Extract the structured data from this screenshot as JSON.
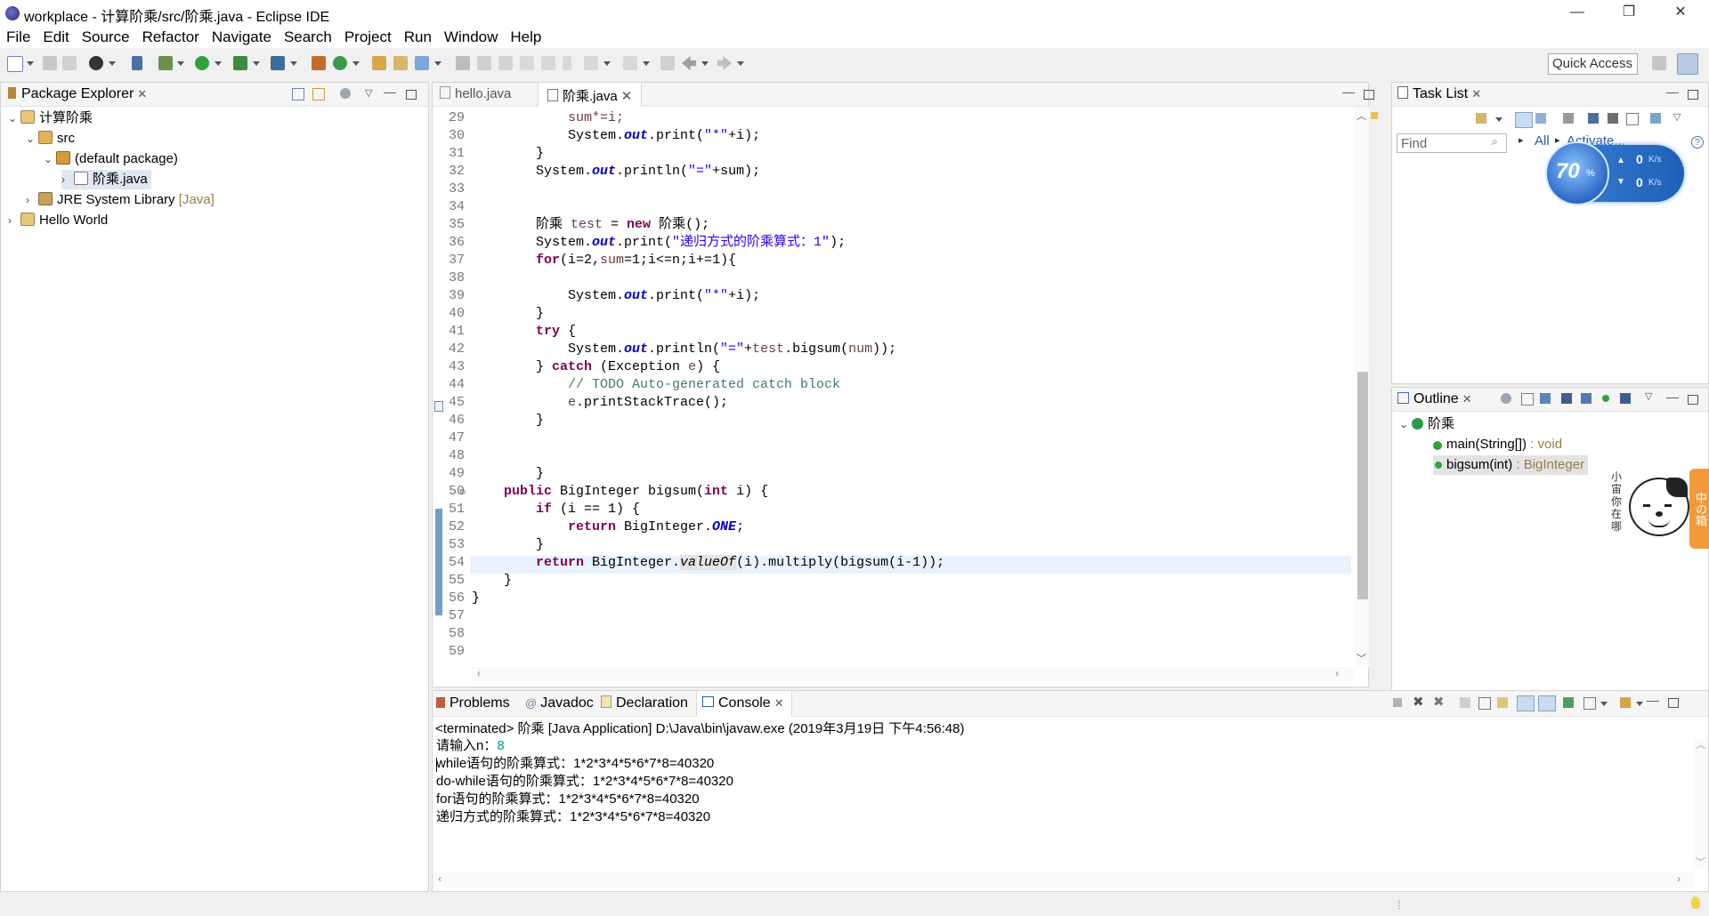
{
  "window": {
    "title": "workplace - 计算阶乘/src/阶乘.java - Eclipse IDE",
    "minimize": "—",
    "maximize": "❐",
    "close": "✕"
  },
  "menu": [
    "File",
    "Edit",
    "Source",
    "Refactor",
    "Navigate",
    "Search",
    "Project",
    "Run",
    "Window",
    "Help"
  ],
  "toolbar": {
    "quick_access": "Quick Access"
  },
  "package_explorer": {
    "title": "Package Explorer",
    "tree": [
      {
        "label": "计算阶乘",
        "chev": "⌄",
        "icon": "project-icon"
      },
      {
        "label": "src",
        "chev": "⌄",
        "icon": "source-folder-icon"
      },
      {
        "label": "(default package)",
        "chev": "⌄",
        "icon": "package-icon"
      },
      {
        "label": "阶乘.java",
        "chev": "›",
        "icon": "java-file-icon"
      },
      {
        "label": "JRE System Library",
        "suffix": "[Java]",
        "chev": "›",
        "icon": "library-icon"
      },
      {
        "label": "Hello World",
        "chev": "›",
        "icon": "project-icon"
      }
    ]
  },
  "editor": {
    "tabs": [
      {
        "label": "hello.java",
        "active": false
      },
      {
        "label": "阶乘.java",
        "active": true
      }
    ],
    "line_numbers": [
      "29",
      "30",
      "31",
      "32",
      "33",
      "34",
      "35",
      "36",
      "37",
      "38",
      "39",
      "40",
      "41",
      "42",
      "43",
      "44",
      "45",
      "46",
      "47",
      "48",
      "49",
      "50",
      "51",
      "52",
      "53",
      "54",
      "55",
      "56",
      "57",
      "58",
      "59"
    ],
    "code": {
      "l29": "sum*=i;",
      "l30a": "System.",
      "l30b": "out",
      "l30c": ".print(",
      "l30d": "\"*\"",
      "l30e": "+i);",
      "l31": "}",
      "l32a": "System.",
      "l32b": "out",
      "l32c": ".println(",
      "l32d": "\"=\"",
      "l32e": "+sum);",
      "l35a": "阶乘 ",
      "l35b": "test",
      "l35c": " = ",
      "l35d": "new",
      "l35e": " 阶乘();",
      "l36a": "System.",
      "l36b": "out",
      "l36c": ".print(",
      "l36d": "\"递归方式的阶乘算式：1\"",
      "l36e": ");",
      "l37a": "for",
      "l37b": "(i=2,",
      "l37c": "sum",
      "l37d": "=1;i<=n;i+=1){",
      "l39a": "System.",
      "l39b": "out",
      "l39c": ".print(",
      "l39d": "\"*\"",
      "l39e": "+i);",
      "l40": "}",
      "l41a": "try",
      "l41b": " {",
      "l42a": "System.",
      "l42b": "out",
      "l42c": ".println(",
      "l42d": "\"=\"",
      "l42e": "+",
      "l42f": "test",
      "l42g": ".bigsum(",
      "l42h": "num",
      "l42i": "));",
      "l43a": "} ",
      "l43b": "catch",
      "l43c": " (Exception ",
      "l43d": "e",
      "l43e": ") {",
      "l44": "// TODO Auto-generated catch block",
      "l45a": "e",
      "l45b": ".printStackTrace();",
      "l46": "}",
      "l49": "}",
      "l50a": "public",
      "l50b": " BigInteger bigsum(",
      "l50c": "int",
      "l50d": " i) {",
      "l51a": "if",
      "l51b": " (i == 1) {",
      "l52a": "return",
      "l52b": " BigInteger.",
      "l52c": "ONE",
      "l52d": ";",
      "l53": "}",
      "l54a": "return",
      "l54b": " BigInteger.",
      "l54c": "valueOf",
      "l54d": "(i).multiply(bigsum(i-1));",
      "l55": "}",
      "l56": "}"
    }
  },
  "task_list": {
    "title": "Task List",
    "find_placeholder": "Find",
    "all_label": "All",
    "activate_label": "Activate...",
    "help": "?"
  },
  "network_widget": {
    "percent": "70",
    "unit": "%",
    "up": "0",
    "down": "0",
    "rate_unit": "K/s"
  },
  "outline": {
    "title": "Outline",
    "class_name": "阶乘",
    "members": [
      {
        "name": "main(String[])",
        "type": " : void"
      },
      {
        "name": "bigsum(int)",
        "type": " : BigInteger"
      }
    ]
  },
  "mascot": {
    "left_text": "小宙你在哪",
    "right_text": "中の箱"
  },
  "bottom_tabs": [
    {
      "label": "Problems",
      "active": false
    },
    {
      "label": "Javadoc",
      "active": false
    },
    {
      "label": "Declaration",
      "active": false
    },
    {
      "label": "Console",
      "active": true
    }
  ],
  "console": {
    "header": "<terminated> 阶乘 [Java Application] D:\\Java\\bin\\javaw.exe (2019年3月19日 下午4:56:48)",
    "prompt": "请输入n：",
    "input": "8",
    "lines": [
      "while语句的阶乘算式：1*2*3*4*5*6*7*8=40320",
      "do-while语句的阶乘算式：1*2*3*4*5*6*7*8=40320",
      "for语句的阶乘算式：1*2*3*4*5*6*7*8=40320",
      "递归方式的阶乘算式：1*2*3*4*5*6*7*8=40320"
    ]
  },
  "colors": {
    "keyword": "#7f0055",
    "string": "#2a00ff",
    "comment": "#3f7f5f",
    "field": "#0000c0",
    "console_input": "#009c9c"
  }
}
